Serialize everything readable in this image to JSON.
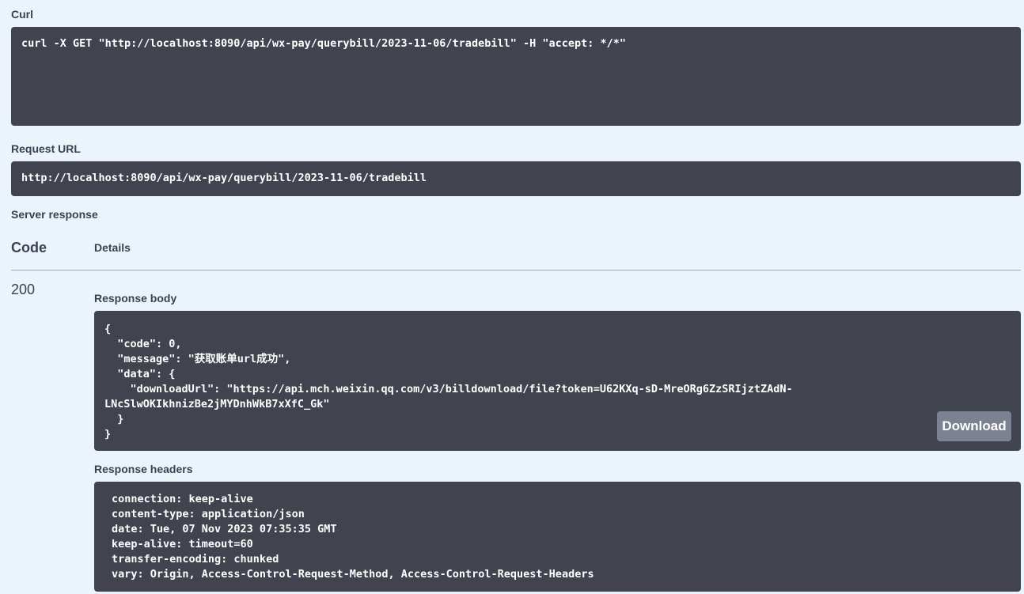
{
  "curl": {
    "title": "Curl",
    "command": "curl -X GET \"http://localhost:8090/api/wx-pay/querybill/2023-11-06/tradebill\" -H \"accept: */*\""
  },
  "request_url": {
    "title": "Request URL",
    "value": "http://localhost:8090/api/wx-pay/querybill/2023-11-06/tradebill"
  },
  "server_response": {
    "title": "Server response",
    "code_header": "Code",
    "details_header": "Details",
    "status_code": "200",
    "body_title": "Response body",
    "body_text": "{\n  \"code\": 0,\n  \"message\": \"获取账单url成功\",\n  \"data\": {\n    \"downloadUrl\": \"https://api.mch.weixin.qq.com/v3/billdownload/file?token=U62KXq-sD-MreORg6ZzSRIjztZAdN-\nLNcSlwOKIkhnizBe2jMYDnhWkB7xXfC_Gk\"\n  }\n}",
    "download_label": "Download",
    "headers_title": "Response headers",
    "headers_text": "connection: keep-alive\ncontent-type: application/json\ndate: Tue, 07 Nov 2023 07:35:35 GMT\nkeep-alive: timeout=60\ntransfer-encoding: chunked\nvary: Origin, Access-Control-Request-Method, Access-Control-Request-Headers"
  }
}
